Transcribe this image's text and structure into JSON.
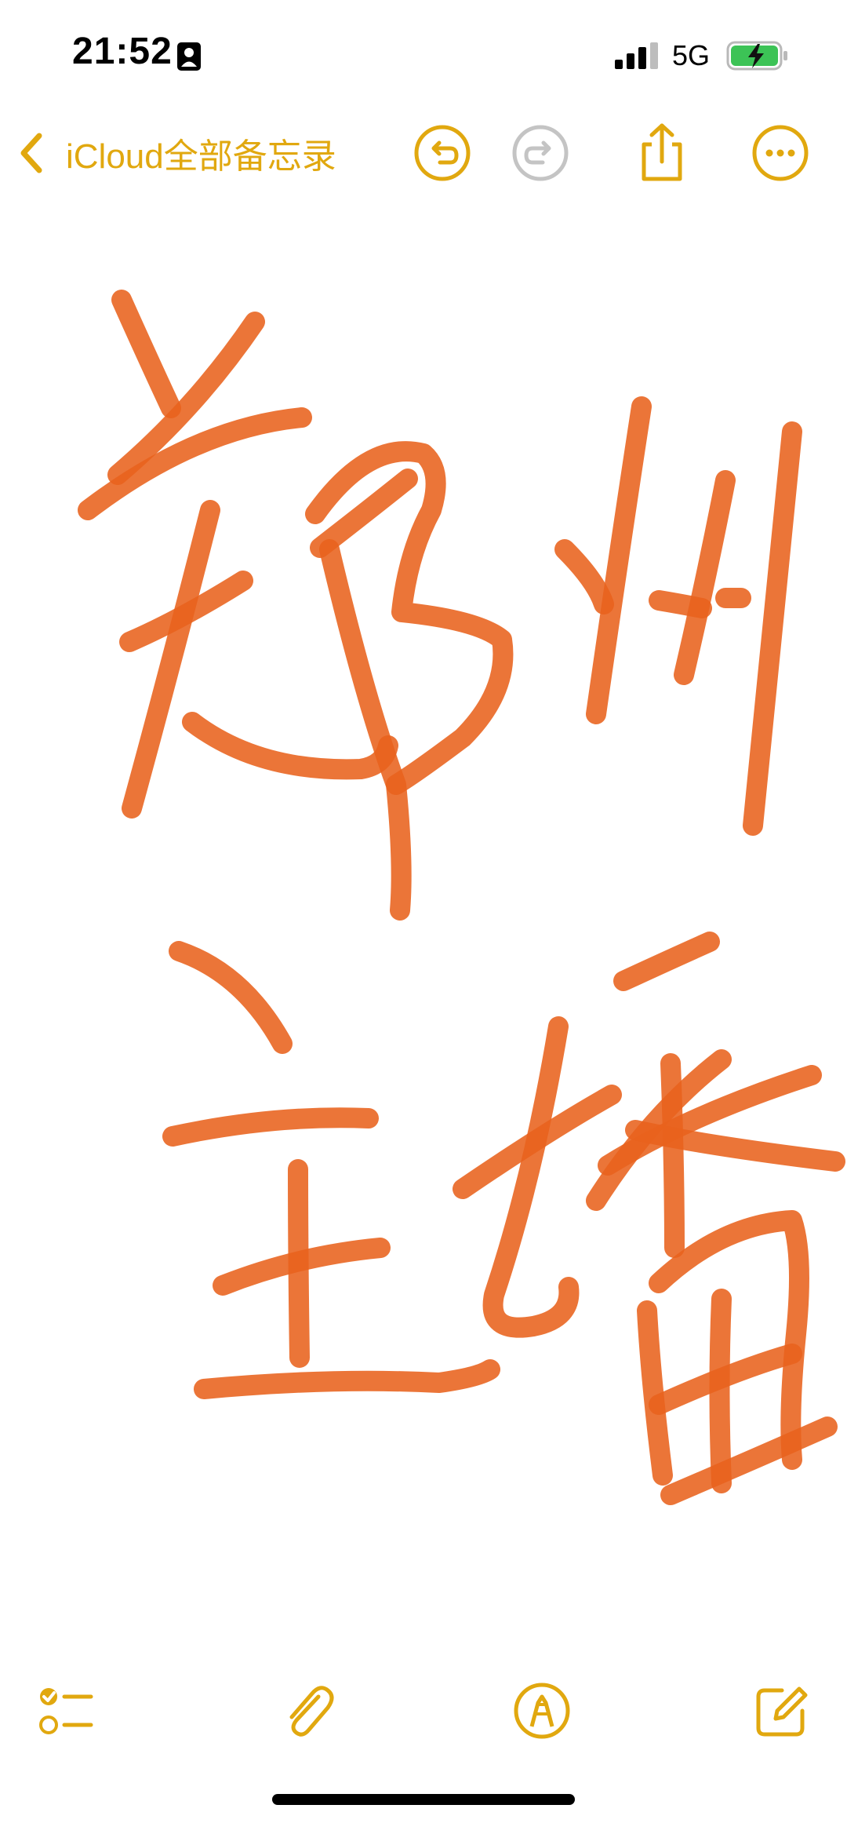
{
  "status_bar": {
    "time": "21:52",
    "network": "5G",
    "icons": [
      "person-badge-icon",
      "cellular-signal-icon",
      "battery-charging-icon"
    ]
  },
  "nav": {
    "back_label": "iCloud全部备忘录",
    "icons": [
      "chevron-left-icon",
      "undo-icon",
      "redo-icon",
      "share-icon",
      "more-icon"
    ]
  },
  "bottom_toolbar": {
    "icons": [
      "checklist-icon",
      "paperclip-icon",
      "markup-pen-icon",
      "compose-icon"
    ]
  },
  "colors": {
    "accent": "#e1a80f",
    "ink": "#e8621c",
    "disabled": "#c4c4c4",
    "battery_fill": "#3cc356"
  },
  "drawing": {
    "content": "handwritten 郑州 主播"
  }
}
